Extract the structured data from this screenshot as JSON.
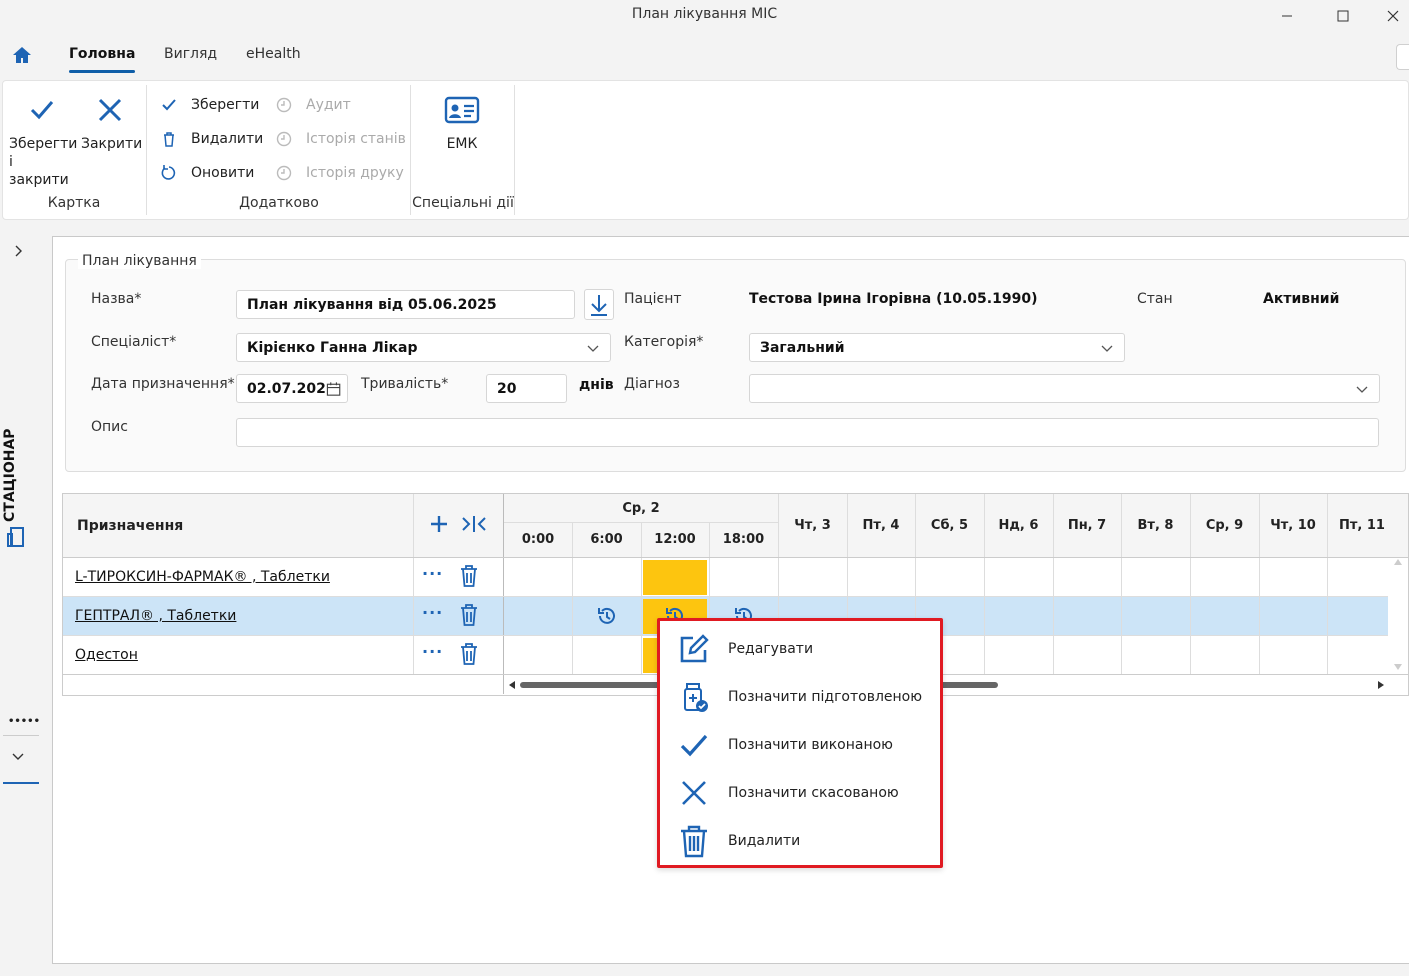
{
  "window": {
    "title": "План лікування МІС"
  },
  "tabs": [
    "Головна",
    "Вигляд",
    "eHealth"
  ],
  "ribbon": {
    "save_close": {
      "line1": "Зберегти",
      "line2": "і закрити"
    },
    "close": "Закрити",
    "group_card": "Картка",
    "save": "Зберегти",
    "delete": "Видалити",
    "refresh": "Оновити",
    "audit": "Аудит",
    "state_history": "Історія станів",
    "print_history": "Історія друку",
    "group_extra": "Додатково",
    "emk": "ЕМК",
    "group_special": "Спеціальні дії"
  },
  "sidebar": {
    "label": "СТАЦІОНАР"
  },
  "form": {
    "legend": "План лікування",
    "name_label": "Назва*",
    "name_value": "План лікування від 05.06.2025",
    "patient_label": "Пацієнт",
    "patient_value": "Тестова Ірина Ігорівна (10.05.1990)",
    "state_label": "Стан",
    "state_value": "Активний",
    "specialist_label": "Спеціаліст*",
    "specialist_value": "Кірієнко Ганна Лікар",
    "category_label": "Категорія*",
    "category_value": "Загальний",
    "date_label": "Дата призначення*",
    "date_value": "02.07.202",
    "duration_label": "Тривалість*",
    "duration_value": "20",
    "duration_unit": "днів",
    "diagnosis_label": "Діагноз",
    "diagnosis_value": "",
    "description_label": "Опис",
    "description_value": ""
  },
  "grid": {
    "header": "Призначення",
    "day_expanded": "Ср, 2",
    "times": [
      "0:00",
      "6:00",
      "12:00",
      "18:00"
    ],
    "days": [
      "Чт, 3",
      "Пт, 4",
      "Сб, 5",
      "Нд, 6",
      "Пн, 7",
      "Вт, 8",
      "Ср, 9",
      "Чт, 10",
      "Пт, 11"
    ],
    "rows": [
      {
        "name": "L-ТИРОКСИН-ФАРМАК® , Таблетки",
        "dots": "···"
      },
      {
        "name": "ГЕПТРАЛ® , Таблетки",
        "dots": "···"
      },
      {
        "name": "Одестон",
        "dots": "···"
      }
    ]
  },
  "context_menu": {
    "items": [
      "Редагувати",
      "Позначити підготовленою",
      "Позначити виконаною",
      "Позначити скасованою",
      "Видалити"
    ]
  },
  "colors": {
    "accent": "#1e64b4",
    "highlight": "#fdc50f",
    "selected_row": "#cce4f7",
    "menu_border": "#e01a22"
  }
}
